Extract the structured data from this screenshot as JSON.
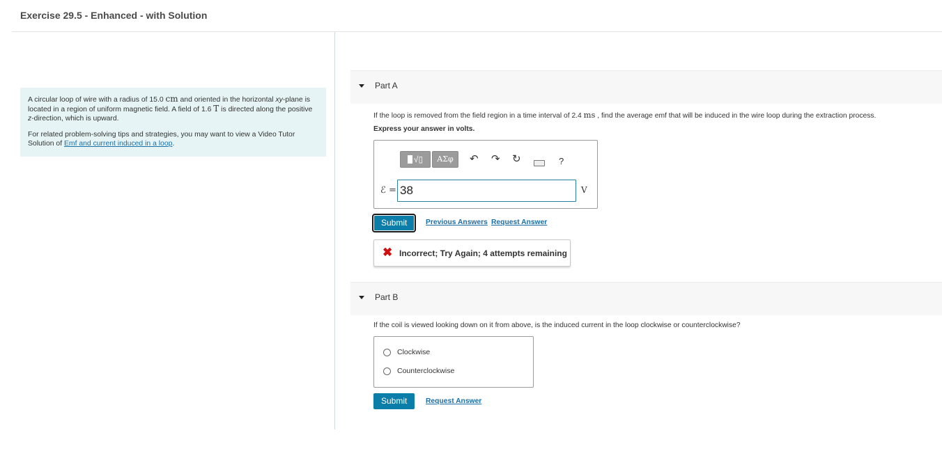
{
  "page": {
    "title": "Exercise 29.5 - Enhanced - with Solution"
  },
  "intro": {
    "p1_a": "A circular loop of wire with a radius of 15.0 ",
    "p1_unit_cm": "cm",
    "p1_b": " and oriented in the horizontal ",
    "p1_xy": "xy",
    "p1_c": "-plane is located in a region of uniform magnetic field. A field of 1.6 ",
    "p1_unit_t": "T",
    "p1_d": " is directed along the positive ",
    "p1_z": "z",
    "p1_e": "-direction, which is upward.",
    "p2_a": "For related problem-solving tips and strategies, you may want to view a Video Tutor Solution of ",
    "p2_link": "Emf and current induced in a loop",
    "p2_b": "."
  },
  "part_a": {
    "label": "Part A",
    "question_a": "If the loop is removed from the field region in a time interval of 2.4 ",
    "question_unit": "ms",
    "question_b": " , find the average emf that will be induced in the wire loop during the extraction process.",
    "instruction": "Express your answer in volts.",
    "toolbar": {
      "symbols_label": "ΑΣφ",
      "undo_glyph": "↶",
      "redo_glyph": "↷",
      "reset_glyph": "↻",
      "help_glyph": "?"
    },
    "variable_label": "ℰ =",
    "answer_value": "38",
    "unit": "V",
    "submit_label": "Submit",
    "previous_answers_label": "Previous Answers",
    "request_answer_label": "Request Answer",
    "feedback_icon": "✖",
    "feedback_message": "Incorrect; Try Again; 4 attempts remaining"
  },
  "part_b": {
    "label": "Part B",
    "question": "If the coil is viewed looking down on it from above, is the induced current in the loop clockwise or counterclockwise?",
    "options": [
      {
        "label": "Clockwise"
      },
      {
        "label": "Counterclockwise"
      }
    ],
    "submit_label": "Submit",
    "request_answer_label": "Request Answer"
  },
  "colors": {
    "accent": "#0a7ea8",
    "link": "#1b6fa8",
    "intro_bg": "#e6f4f5",
    "error": "#d01010"
  }
}
